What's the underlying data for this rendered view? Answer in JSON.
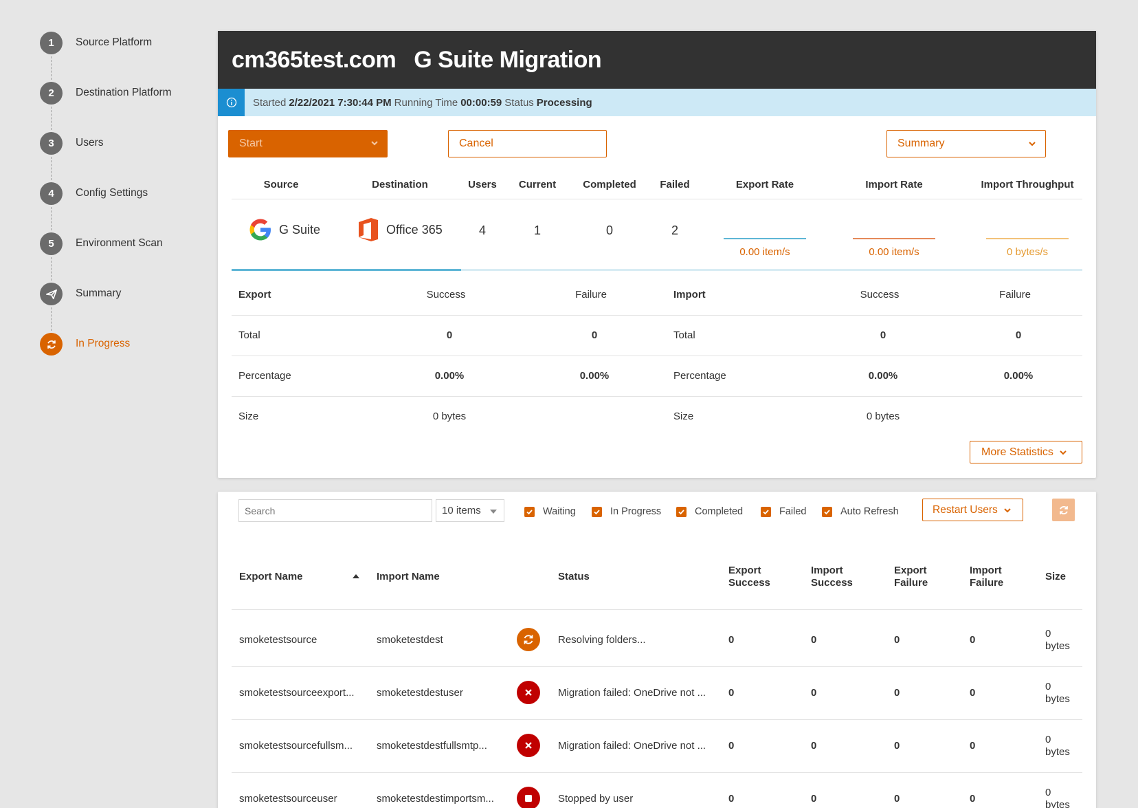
{
  "sidebar": {
    "steps": [
      {
        "num": "1",
        "label": "Source Platform"
      },
      {
        "num": "2",
        "label": "Destination Platform"
      },
      {
        "num": "3",
        "label": "Users"
      },
      {
        "num": "4",
        "label": "Config Settings"
      },
      {
        "num": "5",
        "label": "Environment Scan"
      },
      {
        "num": "",
        "label": "Summary",
        "icon": "paper-plane-icon"
      },
      {
        "num": "",
        "label": "In Progress",
        "icon": "sync-icon",
        "active": true
      }
    ]
  },
  "header": {
    "domain": "cm365test.com",
    "title": "G Suite Migration"
  },
  "info": {
    "started_label": "Started",
    "started_value": "2/22/2021 7:30:44 PM",
    "running_label": "Running Time",
    "running_value": "00:00:59",
    "status_label": "Status",
    "status_value": "Processing"
  },
  "controls": {
    "start": "Start",
    "cancel": "Cancel",
    "summary": "Summary"
  },
  "stats": {
    "headers": {
      "source": "Source",
      "destination": "Destination",
      "users": "Users",
      "current": "Current",
      "completed": "Completed",
      "failed": "Failed",
      "export_rate": "Export Rate",
      "import_rate": "Import Rate",
      "import_throughput": "Import Throughput"
    },
    "source": "G Suite",
    "destination": "Office 365",
    "users": "4",
    "current": "1",
    "completed": "0",
    "failed": "2",
    "export_rate": "0.00 item/s",
    "import_rate": "0.00 item/s",
    "import_throughput": "0 bytes/s",
    "progress_fraction": 0.27,
    "colors": {
      "export": "#5eb6d6",
      "import": "#e58a5a",
      "throughput": "#f2c27a"
    }
  },
  "metrics": {
    "export_label": "Export",
    "import_label": "Import",
    "success": "Success",
    "failure": "Failure",
    "rows": [
      {
        "label": "Total",
        "exp_success": "0",
        "exp_failure": "0",
        "imp_success": "0",
        "imp_failure": "0"
      },
      {
        "label": "Percentage",
        "exp_success": "0.00%",
        "exp_failure": "0.00%",
        "imp_success": "0.00%",
        "imp_failure": "0.00%"
      },
      {
        "label": "Size",
        "exp_success": "0 bytes",
        "exp_failure": "",
        "imp_success": "0 bytes",
        "imp_failure": ""
      }
    ],
    "more_statistics": "More Statistics"
  },
  "users_panel": {
    "search_placeholder": "Search",
    "items_per_page": "10 items",
    "filters": [
      "Waiting",
      "In Progress",
      "Completed",
      "Failed",
      "Auto Refresh"
    ],
    "restart_users": "Restart Users",
    "columns": {
      "export_name": "Export Name",
      "import_name": "Import Name",
      "status": "Status",
      "export_success_1": "Export",
      "export_success_2": "Success",
      "import_success_1": "Import",
      "import_success_2": "Success",
      "export_failure_1": "Export",
      "export_failure_2": "Failure",
      "import_failure_1": "Import",
      "import_failure_2": "Failure",
      "size": "Size"
    },
    "rows": [
      {
        "export_name": "smoketestsource",
        "import_name": "smoketestdest",
        "status_icon": "sync-icon",
        "status": "Resolving folders...",
        "export_success": "0",
        "import_success": "0",
        "export_failure": "0",
        "import_failure": "0",
        "size_num": "0",
        "size_unit": "bytes"
      },
      {
        "export_name": "smoketestsourceexport...",
        "import_name": "smoketestdestuser",
        "status_icon": "error-icon",
        "status": "Migration failed: OneDrive not ...",
        "export_success": "0",
        "import_success": "0",
        "export_failure": "0",
        "import_failure": "0",
        "size_num": "0",
        "size_unit": "bytes"
      },
      {
        "export_name": "smoketestsourcefullsm...",
        "import_name": "smoketestdestfullsmtp...",
        "status_icon": "error-icon",
        "status": "Migration failed: OneDrive not ...",
        "export_success": "0",
        "import_success": "0",
        "export_failure": "0",
        "import_failure": "0",
        "size_num": "0",
        "size_unit": "bytes"
      },
      {
        "export_name": "smoketestsourceuser",
        "import_name": "smoketestdestimportsm...",
        "status_icon": "stop-icon",
        "status": "Stopped by user",
        "export_success": "0",
        "import_success": "0",
        "export_failure": "0",
        "import_failure": "0",
        "size_num": "0",
        "size_unit": "bytes"
      }
    ]
  }
}
